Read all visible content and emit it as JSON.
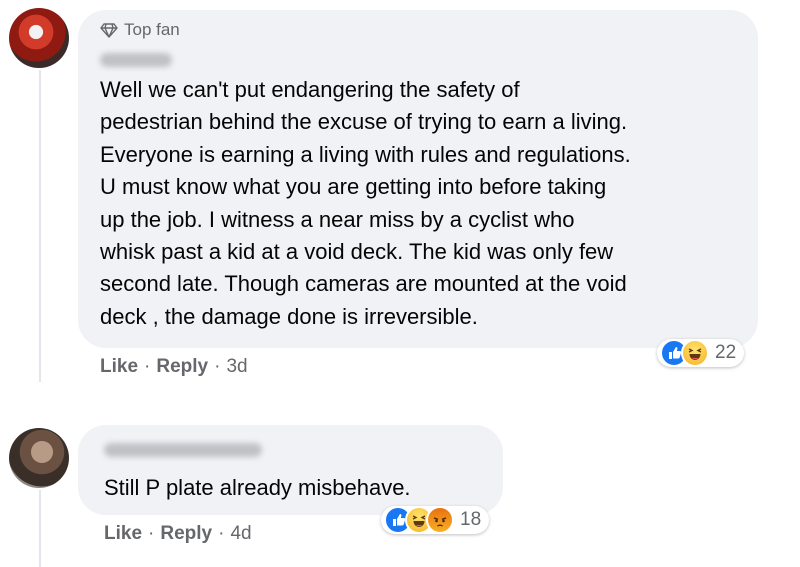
{
  "comments": [
    {
      "badge": "Top fan",
      "text_lines": [
        "Well we can't put endangering the safety of",
        "pedestrian behind the excuse of trying to earn a living.",
        "Everyone is earning a living with rules and regulations.",
        "U must know what you are getting into before taking",
        "up the job. I witness a near miss by a cyclist who",
        "whisk past a kid at a void deck. The kid was only few",
        "second late. Though cameras are mounted at the void",
        "deck , the damage done is irreversible."
      ],
      "like_label": "Like",
      "reply_label": "Reply",
      "separator": "·",
      "time": "3d",
      "reactions": [
        "like-icon",
        "haha-icon"
      ],
      "reaction_count": "22"
    },
    {
      "text": "Still P plate already misbehave.",
      "like_label": "Like",
      "reply_label": "Reply",
      "separator": "·",
      "time": "4d",
      "reactions": [
        "like-icon",
        "haha-icon",
        "angry-icon"
      ],
      "reaction_count": "18"
    }
  ],
  "colors": {
    "bubble": "#f0f2f5",
    "secondary_text": "#65676b",
    "like_blue": "#1877f2",
    "haha_yellow": "#f7b125",
    "angry_orange": "#e9710f"
  }
}
